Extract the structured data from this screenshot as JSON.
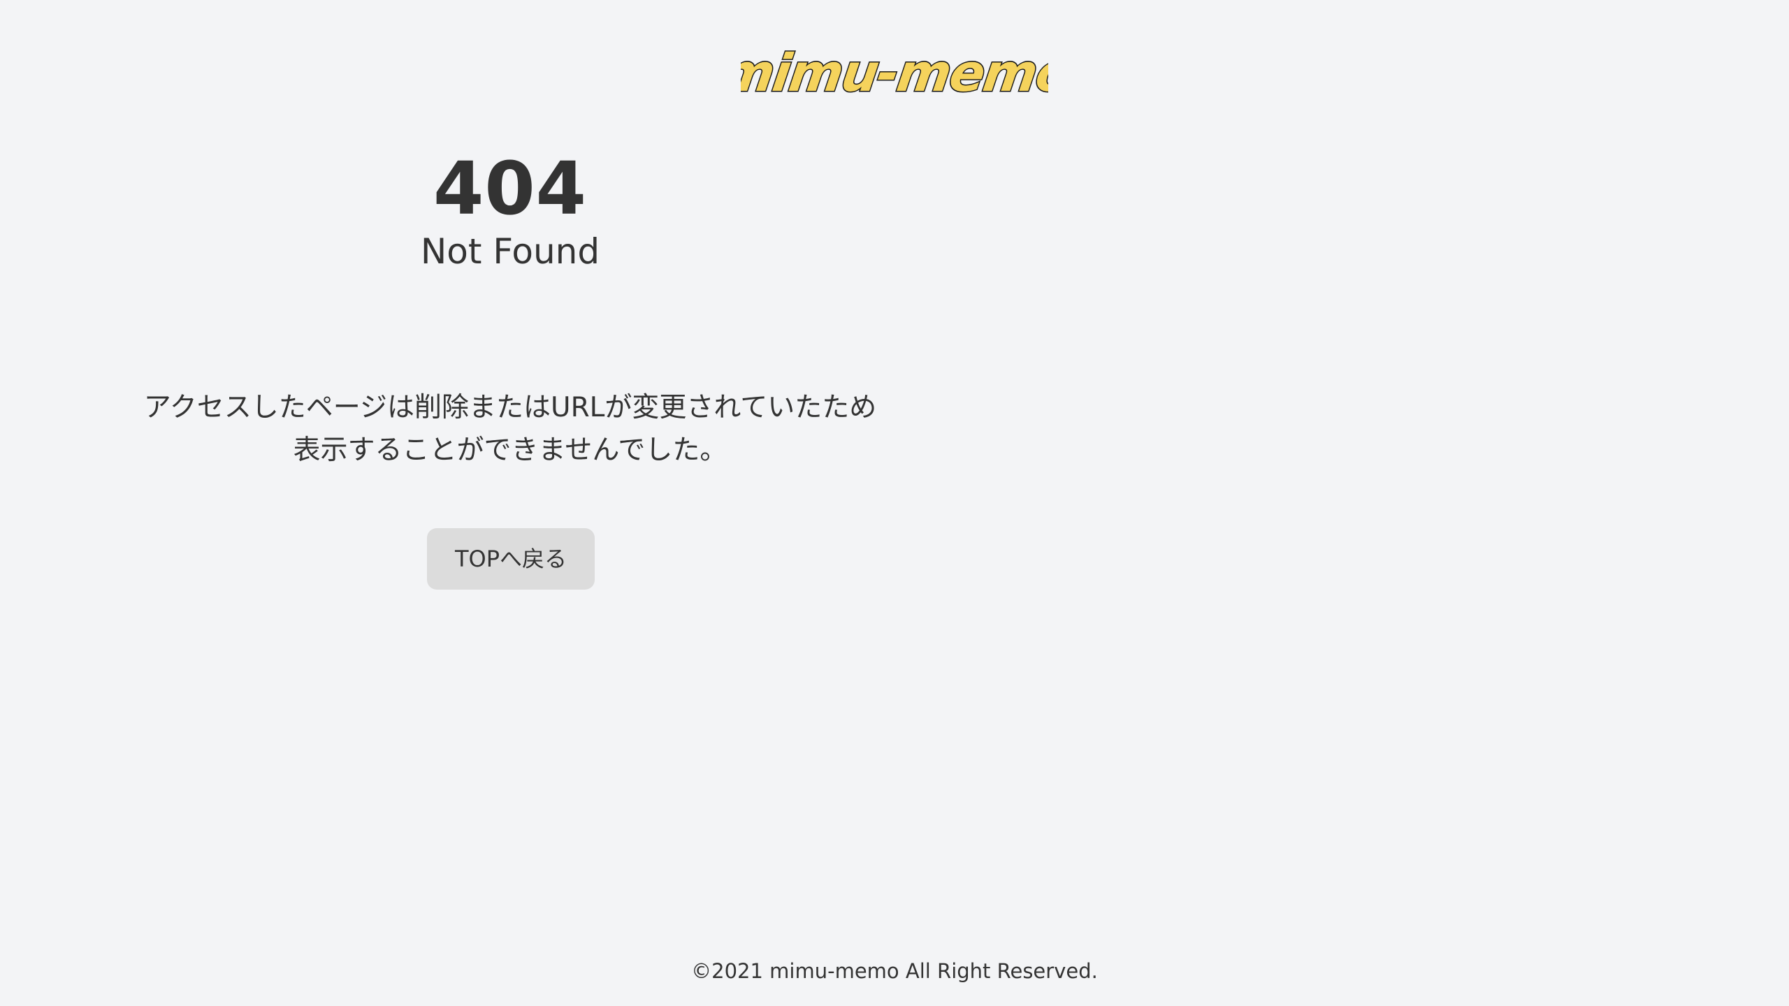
{
  "header": {
    "logo_text": "mimu-memo",
    "logo_fill": "#f5d35c",
    "logo_stroke": "#1a1a1a"
  },
  "error": {
    "code": "404",
    "title": "Not Found"
  },
  "message": {
    "line1": "アクセスしたページは削除またはURLが変更されていたため",
    "line2": "表示することができませんでした。"
  },
  "actions": {
    "top_button_label": "TOPへ戻る"
  },
  "footer": {
    "copyright": "©2021 mimu-memo All Right Reserved."
  },
  "colors": {
    "background": "#f3f4f6",
    "text": "#333333",
    "button_bg": "#dcdcdc"
  }
}
